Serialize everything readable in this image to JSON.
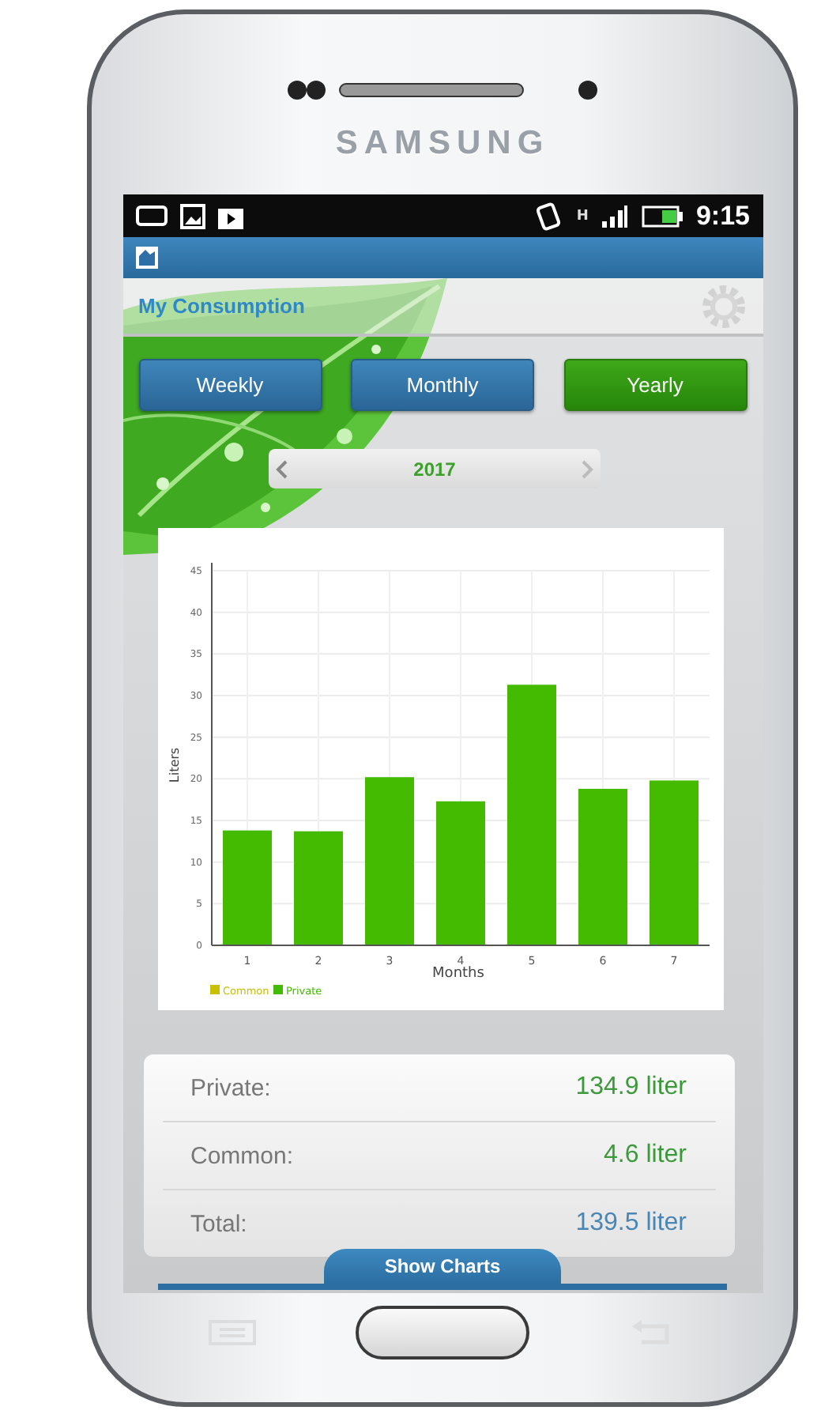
{
  "device": {
    "brand": "SAMSUNG"
  },
  "status_bar": {
    "network_type": "H",
    "time": "9:15"
  },
  "header": {
    "title": "My Consumption"
  },
  "periods": [
    {
      "label": "Weekly",
      "selected": false
    },
    {
      "label": "Monthly",
      "selected": false
    },
    {
      "label": "Yearly",
      "selected": true
    }
  ],
  "year_picker": {
    "value": "2017"
  },
  "chart": {
    "chart_data": {
      "type": "bar",
      "grid": true,
      "xlabel": "Months",
      "ylabel": "Liters",
      "categories": [
        "1",
        "2",
        "3",
        "4",
        "5",
        "6",
        "7"
      ],
      "ylim": [
        0,
        45
      ],
      "yticks": [
        0,
        5,
        10,
        15,
        20,
        25,
        30,
        35,
        40,
        45
      ],
      "series": [
        {
          "name": "Common",
          "color": "#c8c000",
          "values": [
            null,
            null,
            null,
            null,
            null,
            null,
            null
          ]
        },
        {
          "name": "Private",
          "color": "#44bb00",
          "values": [
            13.8,
            13.7,
            20.2,
            17.3,
            31.3,
            18.8,
            19.8
          ]
        }
      ]
    }
  },
  "summary": [
    {
      "label": "Private:",
      "value": "134.9 liter",
      "kind": "green"
    },
    {
      "label": "Common:",
      "value": "4.6 liter",
      "kind": "green"
    },
    {
      "label": "Total:",
      "value": "139.5 liter",
      "kind": "blue"
    }
  ],
  "bottom_tab": {
    "label": "Show Charts"
  }
}
